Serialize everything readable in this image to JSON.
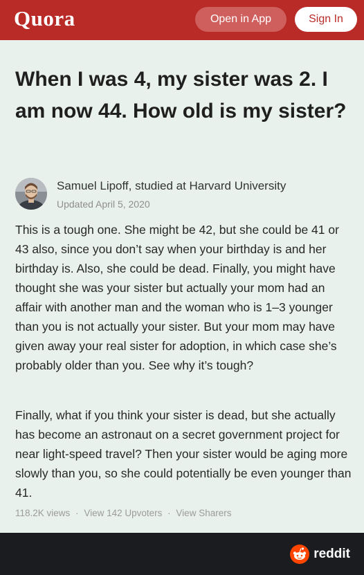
{
  "header": {
    "logo": "Quora",
    "open_in_app": "Open in App",
    "sign_in": "Sign In"
  },
  "question": {
    "title": "When I was 4, my sister was 2. I am now 44. How old is my sister?"
  },
  "answer": {
    "author_line": "Samuel Lipoff, studied at Harvard University",
    "date": "Updated April 5, 2020",
    "paragraphs": [
      "This is a tough one. She might be 42, but she could be 41 or 43 also, since you don’t say when your birthday is and her birthday is. Also, she could be dead. Finally, you might have thought she was your sister but actually your mom had an affair with another man and the woman who is 1–3 younger than you is not actually your sister. But your mom may have given away your real sister for adoption, in which case she’s probably older than you. See why it’s tough?",
      "Finally, what if you think your sister is dead, but she actually has become an astronaut on a secret government project for near light-speed travel? Then your sister would be aging more slowly than you, so she could potentially be even younger than 41."
    ],
    "stats": {
      "views": "118.2K views",
      "upvoters": "View 142 Upvoters",
      "sharers": "View Sharers",
      "separator": "·"
    }
  },
  "footer": {
    "watermark": "reddit",
    "watermark_icon": "reddit-alien-icon"
  },
  "colors": {
    "brand_red": "#b92b27",
    "background": "#e9f1ec",
    "footer": "#1b1c1f",
    "reddit_orange": "#ff4500"
  }
}
